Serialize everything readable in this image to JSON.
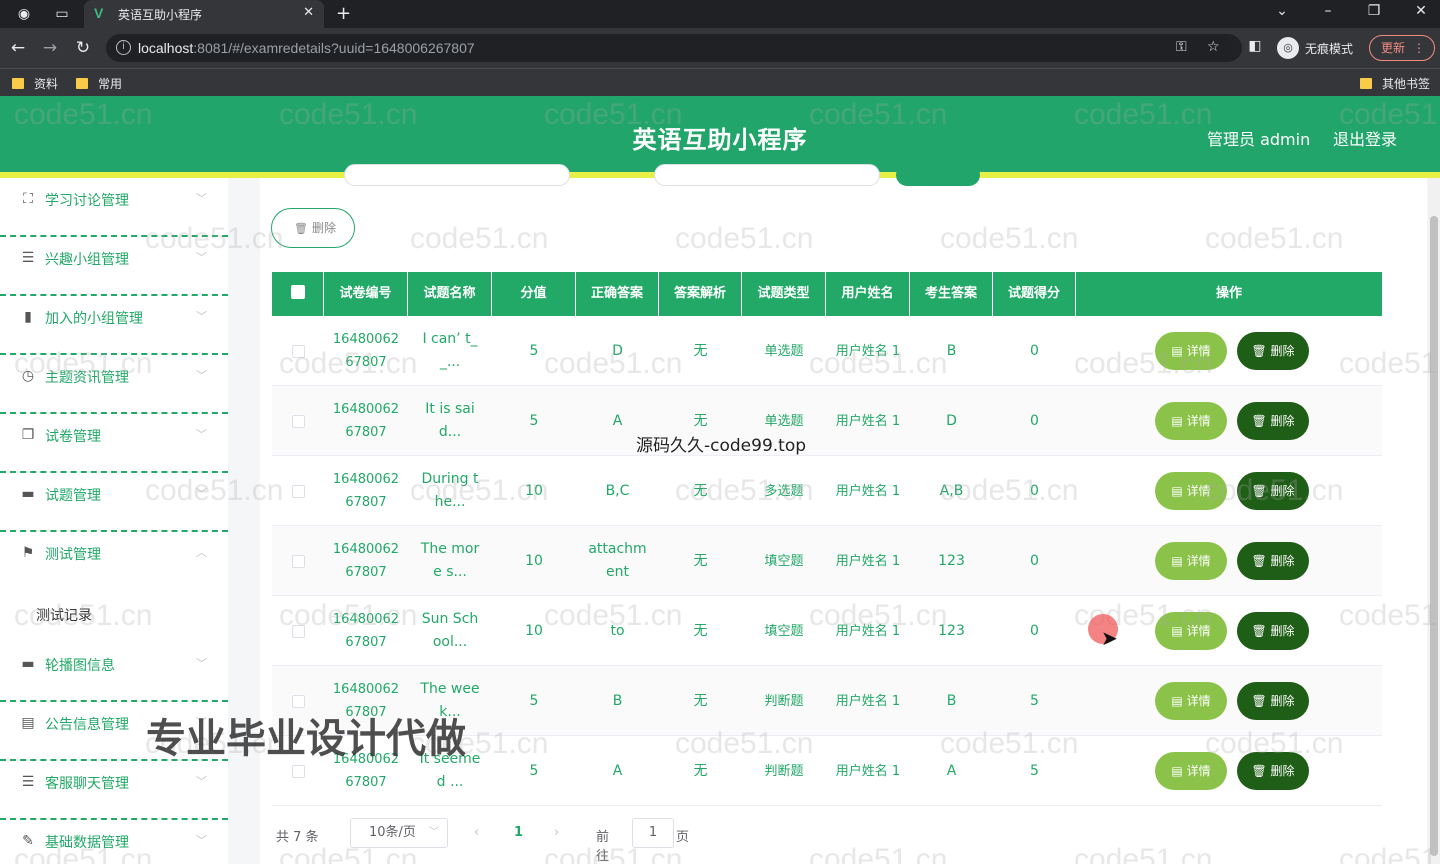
{
  "browser": {
    "tab_title": "英语互助小程序",
    "tab_favicon": "V",
    "url_host": "localhost",
    "url_rest": ":8081/#/examredetails?uuid=1648006267807",
    "profile_label": "无痕模式",
    "update_label": "更新",
    "bookmarks": [
      "资料",
      "常用"
    ],
    "other_bookmarks": "其他书签"
  },
  "header": {
    "title": "英语互助小程序",
    "user": "管理员 admin",
    "logout": "退出登录"
  },
  "sidebar": {
    "items": [
      {
        "label": "学习讨论管理",
        "icon": "frame-icon"
      },
      {
        "label": "兴趣小组管理",
        "icon": "list-icon"
      },
      {
        "label": "加入的小组管理",
        "icon": "bar-chart-icon"
      },
      {
        "label": "主题资讯管理",
        "icon": "clock-icon"
      },
      {
        "label": "试卷管理",
        "icon": "copy-icon"
      },
      {
        "label": "试题管理",
        "icon": "monitor-icon"
      },
      {
        "label": "测试管理",
        "icon": "flag-icon"
      },
      {
        "label": "轮播图信息",
        "icon": "monitor-icon"
      },
      {
        "label": "公告信息管理",
        "icon": "message-icon"
      },
      {
        "label": "客服聊天管理",
        "icon": "sliders-icon"
      },
      {
        "label": "基础数据管理",
        "icon": "edit-icon"
      }
    ],
    "submenu_item": "测试记录"
  },
  "toolbar": {
    "batch_delete": "删除"
  },
  "table": {
    "headers": [
      "试卷编号",
      "试题名称",
      "分值",
      "正确答案",
      "答案解析",
      "试题类型",
      "用户姓名",
      "考生答案",
      "试题得分",
      "操作"
    ],
    "detail_label": "详情",
    "delete_label": "删除",
    "rows": [
      {
        "paper_id": "16480062 67807",
        "question": "I can’ t_ _...",
        "score": "5",
        "answer": "D",
        "analysis": "无",
        "type": "单选题",
        "user": "用户姓名 1",
        "student_answer": "B",
        "earned": "0"
      },
      {
        "paper_id": "16480062 67807",
        "question": "It is sai d...",
        "score": "5",
        "answer": "A",
        "analysis": "无",
        "type": "单选题",
        "user": "用户姓名 1",
        "student_answer": "D",
        "earned": "0"
      },
      {
        "paper_id": "16480062 67807",
        "question": "During t he...",
        "score": "10",
        "answer": "B,C",
        "analysis": "无",
        "type": "多选题",
        "user": "用户姓名 1",
        "student_answer": "A,B",
        "earned": "0"
      },
      {
        "paper_id": "16480062 67807",
        "question": "The mor e s...",
        "score": "10",
        "answer": "attachm ent",
        "analysis": "无",
        "type": "填空题",
        "user": "用户姓名 1",
        "student_answer": "123",
        "earned": "0"
      },
      {
        "paper_id": "16480062 67807",
        "question": "Sun Sch ool...",
        "score": "10",
        "answer": "to",
        "analysis": "无",
        "type": "填空题",
        "user": "用户姓名 1",
        "student_answer": "123",
        "earned": "0"
      },
      {
        "paper_id": "16480062 67807",
        "question": "The wee k...",
        "score": "5",
        "answer": "B",
        "analysis": "无",
        "type": "判断题",
        "user": "用户姓名 1",
        "student_answer": "B",
        "earned": "5"
      },
      {
        "paper_id": "16480062 67807",
        "question": "It seeme d ...",
        "score": "5",
        "answer": "A",
        "analysis": "无",
        "type": "判断题",
        "user": "用户姓名 1",
        "student_answer": "A",
        "earned": "5"
      }
    ]
  },
  "pagination": {
    "total": "共 7 条",
    "page_size": "10条/页",
    "current_page": "1",
    "goto_label": "前往",
    "goto_value": "1",
    "page_unit": "页"
  },
  "overlays": {
    "watermark": "code51.cn",
    "code99": "源码久久-code99.top",
    "banner": "专业毕业设计代做"
  },
  "colors": {
    "primary": "#21a56a",
    "stripe": "#e8f046",
    "detail_button": "#8bc34a",
    "delete_button": "#1f5e16"
  }
}
